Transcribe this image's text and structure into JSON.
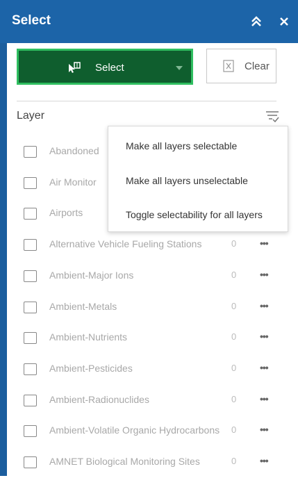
{
  "header": {
    "title": "Select",
    "collapse_icon": "double-chevron-up-icon",
    "close_icon": "close-icon"
  },
  "toolbar": {
    "select_label": "Select",
    "clear_label": "Clear"
  },
  "layer_list": {
    "header_label": "Layer",
    "rows": [
      {
        "name": "Abandoned",
        "count": ""
      },
      {
        "name": "Air Monitor",
        "count": ""
      },
      {
        "name": "Airports",
        "count": ""
      },
      {
        "name": "Alternative Vehicle Fueling Stations",
        "count": "0"
      },
      {
        "name": "Ambient-Major Ions",
        "count": "0"
      },
      {
        "name": "Ambient-Metals",
        "count": "0"
      },
      {
        "name": "Ambient-Nutrients",
        "count": "0"
      },
      {
        "name": "Ambient-Pesticides",
        "count": "0"
      },
      {
        "name": "Ambient-Radionuclides",
        "count": "0"
      },
      {
        "name": "Ambient-Volatile Organic Hydrocarbons",
        "count": "0"
      },
      {
        "name": "AMNET Biological Monitoring Sites",
        "count": "0"
      }
    ],
    "more_label": "•••"
  },
  "menu": {
    "items": [
      "Make all layers selectable",
      "Make all layers unselectable",
      "Toggle selectability for all layers"
    ]
  },
  "colors": {
    "header_bg": "#1c64a8",
    "select_bg": "#0f5e2e",
    "select_border": "#2fbf60"
  }
}
